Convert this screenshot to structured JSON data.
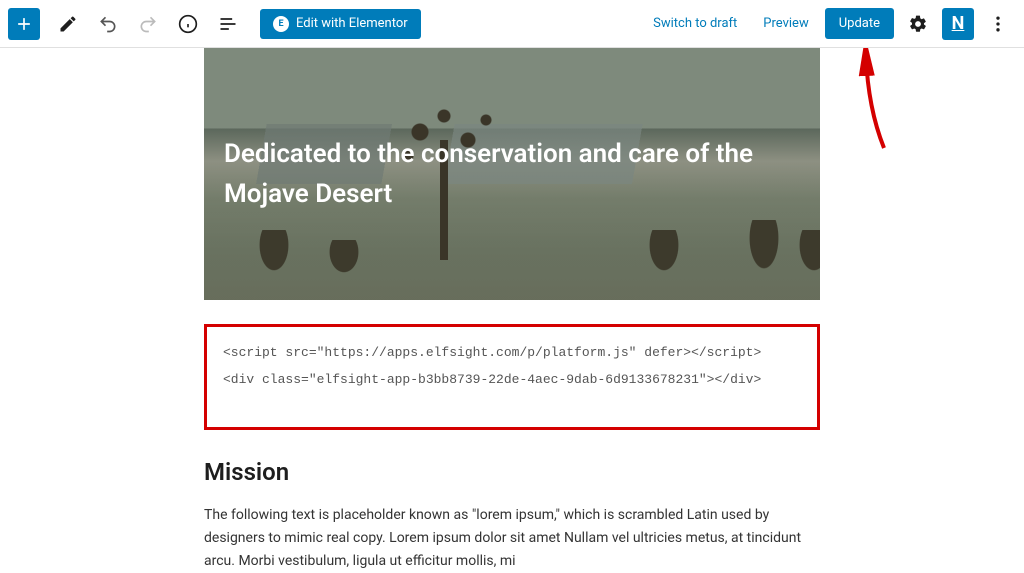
{
  "toolbar": {
    "elementor_label": "Edit with Elementor",
    "switch_draft": "Switch to draft",
    "preview": "Preview",
    "update": "Update"
  },
  "hero": {
    "heading": "Dedicated to the conservation and care of the Mojave Desert"
  },
  "code": {
    "line1": "<script src=\"https://apps.elfsight.com/p/platform.js\" defer></script>",
    "line2": "<div class=\"elfsight-app-b3bb8739-22de-4aec-9dab-6d9133678231\"></div>"
  },
  "section": {
    "title": "Mission",
    "body": "The following text is placeholder known as \"lorem ipsum,\" which is scrambled Latin used by designers to mimic real copy. Lorem ipsum dolor sit amet Nullam vel ultricies metus, at tincidunt arcu. Morbi vestibulum, ligula ut efficitur mollis, mi"
  }
}
